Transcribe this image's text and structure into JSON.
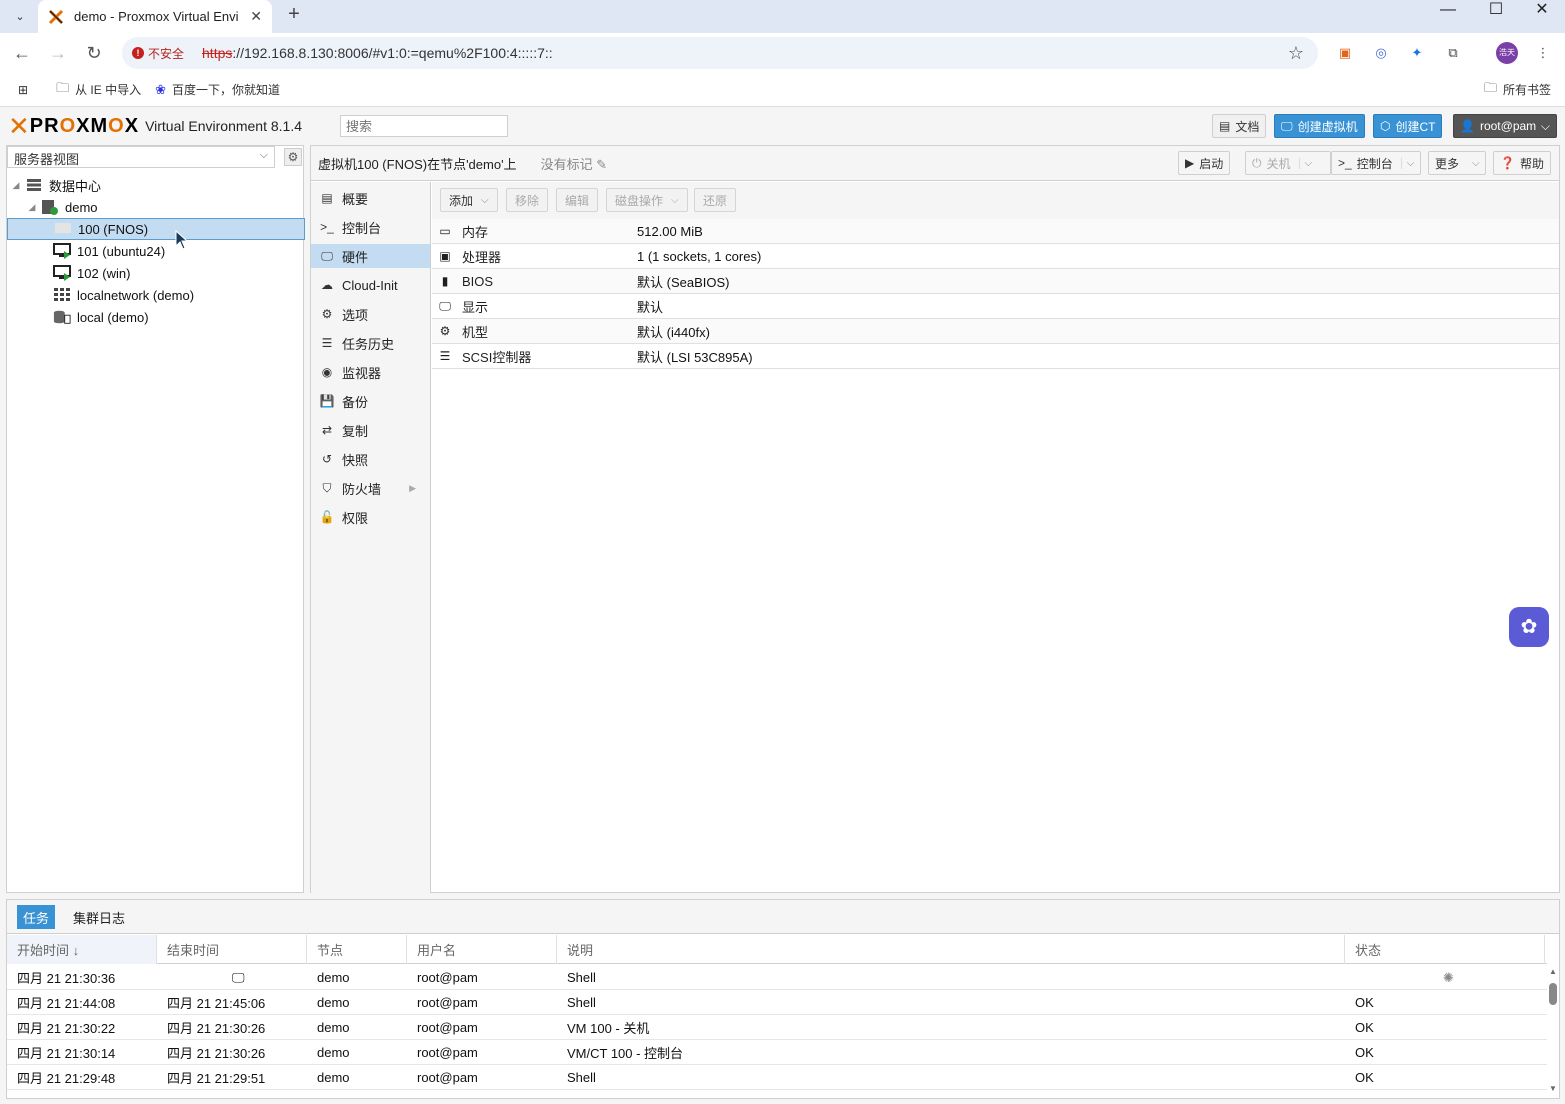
{
  "browser": {
    "tab_title": "demo - Proxmox Virtual Envi",
    "url_scheme": "https",
    "url_rest": "://192.168.8.130:8006/#v1:0:=qemu%2F100:4:::::7::",
    "insecure_label": "不安全",
    "bookmarks": [
      {
        "icon": "folder-icon",
        "label": "从 IE 中导入"
      },
      {
        "icon": "baidu-icon",
        "label": "百度一下，你就知道"
      }
    ],
    "all_bookmarks_label": "所有书签",
    "profile_initials": "浩天"
  },
  "header": {
    "logo_text_1": "PR",
    "logo_text_o1": "O",
    "logo_text_2": "XM",
    "logo_text_o2": "O",
    "logo_text_3": "X",
    "version": "Virtual Environment 8.1.4",
    "search_placeholder": "搜索",
    "docs_label": "文档",
    "create_vm_label": "创建虚拟机",
    "create_ct_label": "创建CT",
    "user_label": "root@pam"
  },
  "tree": {
    "view_label": "服务器视图",
    "items": [
      {
        "label": "数据中心",
        "icon": "datacenter-icon"
      },
      {
        "label": "demo",
        "icon": "node-icon"
      },
      {
        "label": "100 (FNOS)",
        "icon": "vm-stopped-icon"
      },
      {
        "label": "101 (ubuntu24)",
        "icon": "vm-running-icon"
      },
      {
        "label": "102 (win)",
        "icon": "vm-running-icon"
      },
      {
        "label": "localnetwork (demo)",
        "icon": "network-icon"
      },
      {
        "label": "local (demo)",
        "icon": "storage-icon"
      }
    ]
  },
  "content": {
    "title": "虚拟机100 (FNOS)在节点'demo'上",
    "tags_label": "没有标记",
    "buttons": {
      "start": "启动",
      "shutdown": "关机",
      "console": "控制台",
      "more": "更多",
      "help": "帮助"
    },
    "menu": [
      {
        "icon": "summary-icon",
        "label": "概要"
      },
      {
        "icon": "console-icon",
        "label": "控制台"
      },
      {
        "icon": "hardware-icon",
        "label": "硬件"
      },
      {
        "icon": "cloud-icon",
        "label": "Cloud-Init"
      },
      {
        "icon": "options-gear-icon",
        "label": "选项"
      },
      {
        "icon": "task-history-icon",
        "label": "任务历史"
      },
      {
        "icon": "monitor-eye-icon",
        "label": "监视器"
      },
      {
        "icon": "backup-icon",
        "label": "备份"
      },
      {
        "icon": "replication-icon",
        "label": "复制"
      },
      {
        "icon": "snapshot-icon",
        "label": "快照"
      },
      {
        "icon": "firewall-shield-icon",
        "label": "防火墙"
      },
      {
        "icon": "permissions-lock-icon",
        "label": "权限"
      }
    ],
    "toolbar": {
      "add": "添加",
      "remove": "移除",
      "edit": "编辑",
      "disk_action": "磁盘操作",
      "revert": "还原"
    },
    "hardware": [
      {
        "icon": "memory-icon",
        "key": "内存",
        "value": "512.00 MiB"
      },
      {
        "icon": "cpu-icon",
        "key": "处理器",
        "value": "1 (1 sockets, 1 cores)"
      },
      {
        "icon": "bios-chip-icon",
        "key": "BIOS",
        "value": "默认 (SeaBIOS)"
      },
      {
        "icon": "display-icon",
        "key": "显示",
        "value": "默认"
      },
      {
        "icon": "machine-gears-icon",
        "key": "机型",
        "value": "默认 (i440fx)"
      },
      {
        "icon": "scsi-database-icon",
        "key": "SCSI控制器",
        "value": "默认 (LSI 53C895A)"
      }
    ]
  },
  "tasks": {
    "tabs": [
      "任务",
      "集群日志"
    ],
    "columns": [
      "开始时间 ↓",
      "结束时间",
      "节点",
      "用户名",
      "说明",
      "状态"
    ],
    "rows": [
      {
        "start": "四月 21 21:30:36",
        "end": "",
        "node": "demo",
        "user": "root@pam",
        "desc": "Shell",
        "status": ""
      },
      {
        "start": "四月 21 21:44:08",
        "end": "四月 21 21:45:06",
        "node": "demo",
        "user": "root@pam",
        "desc": "Shell",
        "status": "OK"
      },
      {
        "start": "四月 21 21:30:22",
        "end": "四月 21 21:30:26",
        "node": "demo",
        "user": "root@pam",
        "desc": "VM 100 - 关机",
        "status": "OK"
      },
      {
        "start": "四月 21 21:30:14",
        "end": "四月 21 21:30:26",
        "node": "demo",
        "user": "root@pam",
        "desc": "VM/CT 100 - 控制台",
        "status": "OK"
      },
      {
        "start": "四月 21 21:29:48",
        "end": "四月 21 21:29:51",
        "node": "demo",
        "user": "root@pam",
        "desc": "Shell",
        "status": "OK"
      }
    ]
  },
  "colors": {
    "brand_orange": "#e57000",
    "accent_blue": "#3892d4",
    "selection": "#c4dcf1"
  }
}
